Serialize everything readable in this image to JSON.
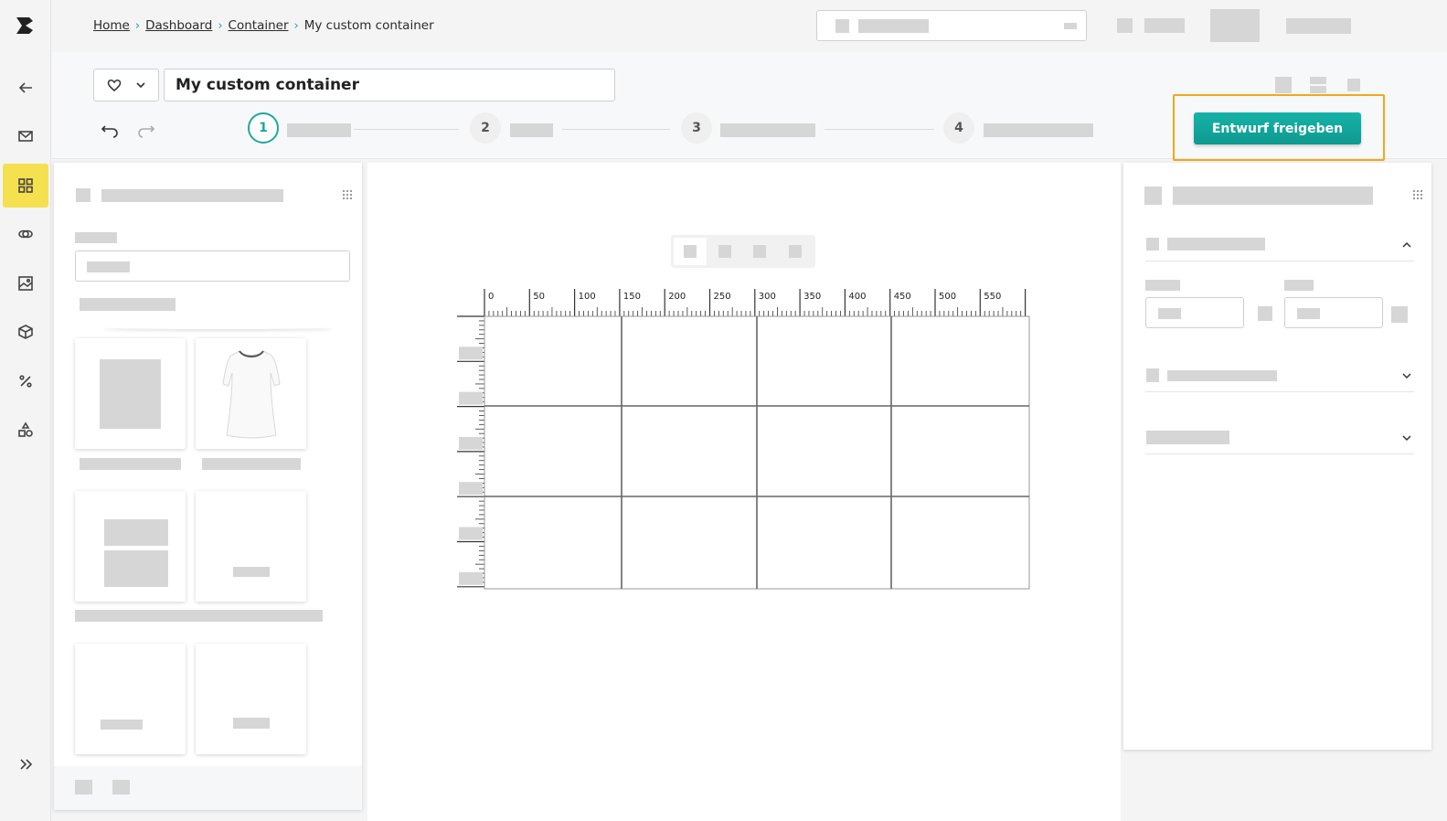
{
  "breadcrumb": {
    "home": "Home",
    "dashboard": "Dashboard",
    "container": "Container",
    "current": "My custom container"
  },
  "editor": {
    "title": "My custom container",
    "release_label": "Entwurf freigeben"
  },
  "steps": [
    {
      "number": "1"
    },
    {
      "number": "2"
    },
    {
      "number": "3"
    },
    {
      "number": "4"
    }
  ],
  "ruler": {
    "x_ticks": [
      "0",
      "50",
      "100",
      "150",
      "200",
      "250",
      "300",
      "350",
      "400",
      "450",
      "500",
      "550"
    ]
  },
  "nav_icons": [
    "back-arrow-icon",
    "mail-icon",
    "grid-icon",
    "link-icon",
    "image-icon",
    "cube-icon",
    "percent-icon",
    "shapes-icon",
    "double-chevron-right-icon"
  ],
  "colors": {
    "accent": "#1fa7a0",
    "highlight": "#f0a81c",
    "nav_active": "#f5e050"
  }
}
